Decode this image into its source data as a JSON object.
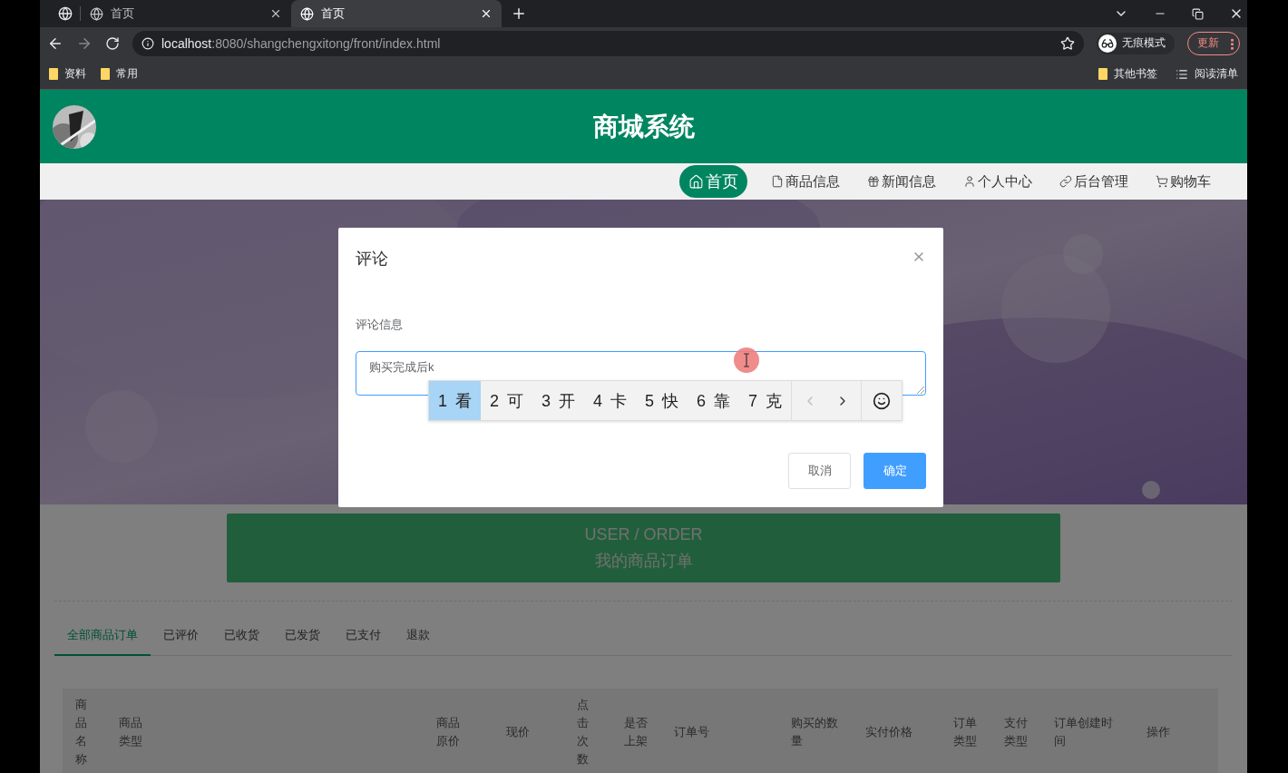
{
  "browser": {
    "tabs": [
      {
        "title": "首页",
        "selected": false
      },
      {
        "title": "首页",
        "selected": true
      }
    ],
    "url": {
      "host": "localhost",
      "path": ":8080/shangchengxitong/front/index.html"
    },
    "profile_label": "无痕模式",
    "update_button": "更新",
    "bookmarks": [
      "资料",
      "常用"
    ],
    "bookmarks_right": [
      {
        "kind": "folder",
        "label": "其他书签"
      },
      {
        "kind": "list",
        "label": "阅读清单"
      }
    ]
  },
  "site": {
    "title": "商城系统",
    "nav": [
      {
        "kind": "home",
        "label": "首页",
        "selected": true
      },
      {
        "kind": "file",
        "label": "商品信息",
        "selected": false
      },
      {
        "kind": "gift",
        "label": "新闻信息",
        "selected": false
      },
      {
        "kind": "user",
        "label": "个人中心",
        "selected": false
      },
      {
        "kind": "link",
        "label": "后台管理",
        "selected": false
      },
      {
        "kind": "cart",
        "label": "购物车",
        "selected": false
      }
    ]
  },
  "dialog": {
    "title": "评论",
    "field_label": "评论信息",
    "value": "购买完成后k",
    "ime_candidates": [
      {
        "number": "1",
        "char": "看",
        "selected": true
      },
      {
        "number": "2",
        "char": "可",
        "selected": false
      },
      {
        "number": "3",
        "char": "开",
        "selected": false
      },
      {
        "number": "4",
        "char": "卡",
        "selected": false
      },
      {
        "number": "5",
        "char": "快",
        "selected": false
      },
      {
        "number": "6",
        "char": "靠",
        "selected": false
      },
      {
        "number": "7",
        "char": "克",
        "selected": false
      }
    ],
    "cancel": "取消",
    "confirm": "确定"
  },
  "banner": {
    "subtitle": "USER / ORDER",
    "title": "我的商品订单"
  },
  "order_tabs": [
    {
      "label": "全部商品订单",
      "selected": true
    },
    {
      "label": "已评价",
      "selected": false
    },
    {
      "label": "已收货",
      "selected": false
    },
    {
      "label": "已发货",
      "selected": false
    },
    {
      "label": "已支付",
      "selected": false
    },
    {
      "label": "退款",
      "selected": false
    }
  ],
  "table": {
    "columns": [
      "商品名称",
      "商品类型",
      "商品原价",
      "现价",
      "点击次数",
      "是否上架",
      "订单号",
      "购买的数量",
      "实付价格",
      "订单类型",
      "支付类型",
      "订单创建时间",
      "操作"
    ]
  }
}
